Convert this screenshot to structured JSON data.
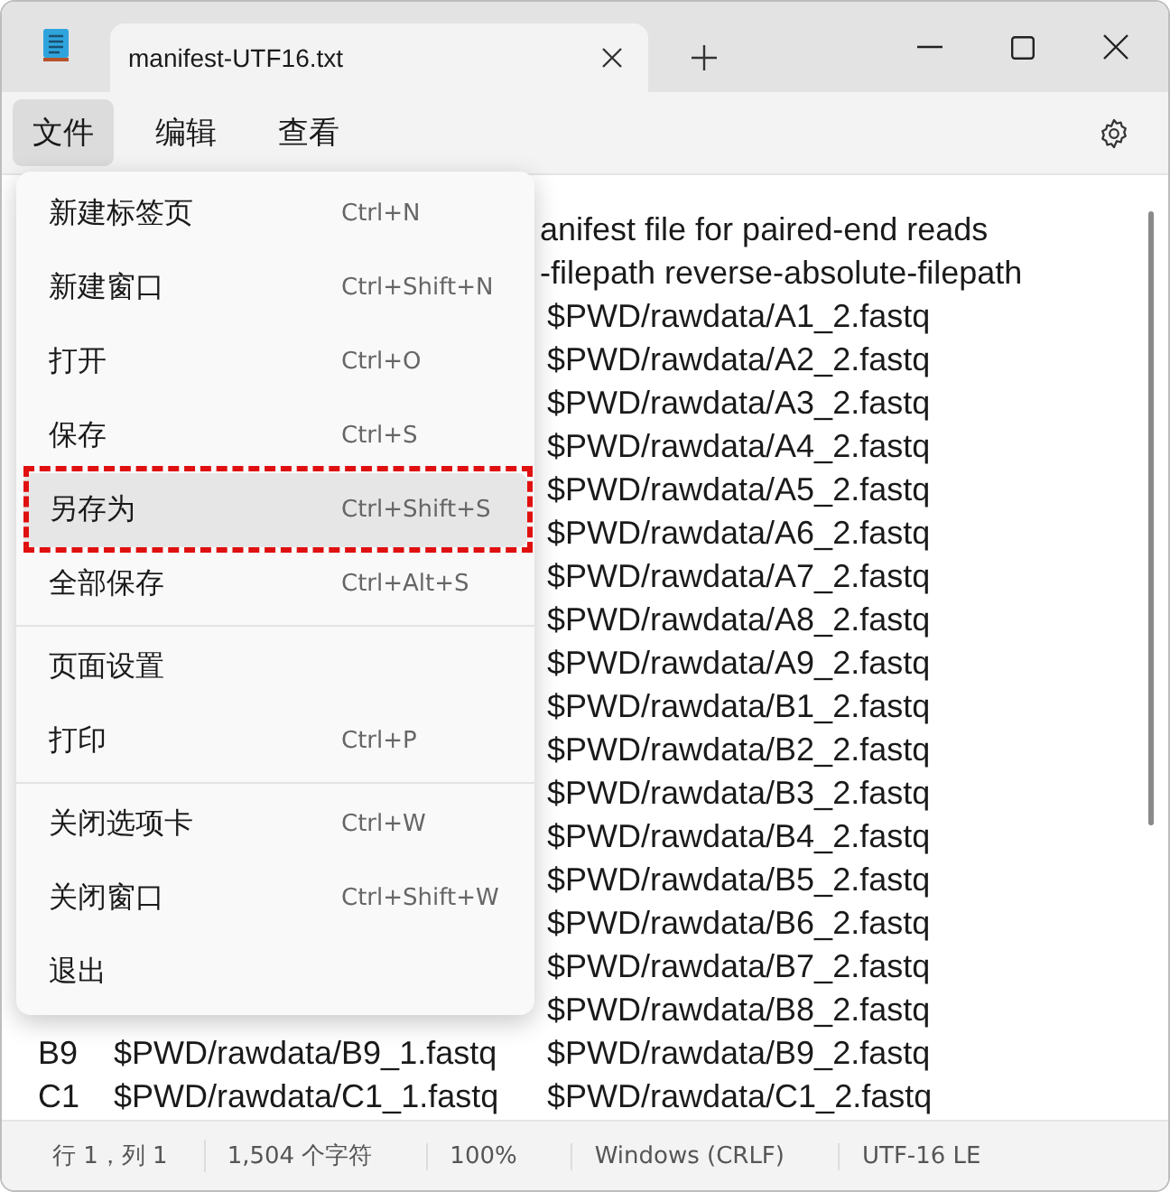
{
  "window": {
    "tab_title": "manifest-UTF16.txt"
  },
  "menubar": [
    {
      "label": "文件",
      "selected": true
    },
    {
      "label": "编辑",
      "selected": false
    },
    {
      "label": "查看",
      "selected": false
    }
  ],
  "file_menu": [
    {
      "kind": "item",
      "label": "新建标签页",
      "shortcut": "Ctrl+N",
      "selected": false,
      "marked": false
    },
    {
      "kind": "item",
      "label": "新建窗口",
      "shortcut": "Ctrl+Shift+N",
      "selected": false,
      "marked": false
    },
    {
      "kind": "item",
      "label": "打开",
      "shortcut": "Ctrl+O",
      "selected": false,
      "marked": false
    },
    {
      "kind": "item",
      "label": "保存",
      "shortcut": "Ctrl+S",
      "selected": false,
      "marked": false
    },
    {
      "kind": "item",
      "label": "另存为",
      "shortcut": "Ctrl+Shift+S",
      "selected": true,
      "marked": true
    },
    {
      "kind": "item",
      "label": "全部保存",
      "shortcut": "Ctrl+Alt+S",
      "selected": false,
      "marked": false
    },
    {
      "kind": "separator"
    },
    {
      "kind": "item",
      "label": "页面设置",
      "selected": false,
      "marked": false
    },
    {
      "kind": "item",
      "label": "打印",
      "shortcut": "Ctrl+P",
      "selected": false,
      "marked": false
    },
    {
      "kind": "separator"
    },
    {
      "kind": "item",
      "label": "关闭选项卡",
      "shortcut": "Ctrl+W",
      "selected": false,
      "marked": false
    },
    {
      "kind": "item",
      "label": "关闭窗口",
      "shortcut": "Ctrl+Shift+W",
      "selected": false,
      "marked": false
    },
    {
      "kind": "item",
      "label": "退出",
      "selected": false,
      "marked": false
    }
  ],
  "editor": {
    "header_lines": [
      "anifest file for paired-end reads",
      "-filepath   reverse-absolute-filepath"
    ],
    "rows": [
      {
        "reverse": "$PWD/rawdata/A1_2.fastq"
      },
      {
        "reverse": "$PWD/rawdata/A2_2.fastq"
      },
      {
        "reverse": "$PWD/rawdata/A3_2.fastq"
      },
      {
        "reverse": "$PWD/rawdata/A4_2.fastq"
      },
      {
        "reverse": "$PWD/rawdata/A5_2.fastq"
      },
      {
        "reverse": "$PWD/rawdata/A6_2.fastq"
      },
      {
        "reverse": "$PWD/rawdata/A7_2.fastq"
      },
      {
        "reverse": "$PWD/rawdata/A8_2.fastq"
      },
      {
        "reverse": "$PWD/rawdata/A9_2.fastq"
      },
      {
        "reverse": "$PWD/rawdata/B1_2.fastq"
      },
      {
        "reverse": "$PWD/rawdata/B2_2.fastq"
      },
      {
        "reverse": "$PWD/rawdata/B3_2.fastq"
      },
      {
        "reverse": "$PWD/rawdata/B4_2.fastq"
      },
      {
        "reverse": "$PWD/rawdata/B5_2.fastq"
      },
      {
        "reverse": "$PWD/rawdata/B6_2.fastq"
      },
      {
        "reverse": "$PWD/rawdata/B7_2.fastq"
      },
      {
        "reverse": "$PWD/rawdata/B8_2.fastq"
      },
      {
        "sample": "B9",
        "forward": "$PWD/rawdata/B9_1.fastq",
        "reverse": "$PWD/rawdata/B9_2.fastq"
      },
      {
        "sample": "C1",
        "forward": "$PWD/rawdata/C1_1.fastq",
        "reverse": "$PWD/rawdata/C1_2.fastq"
      }
    ]
  },
  "status_bar": [
    "行 1，列 1",
    "1,504 个字符",
    "100%",
    "Windows (CRLF)",
    "UTF-16 LE"
  ]
}
